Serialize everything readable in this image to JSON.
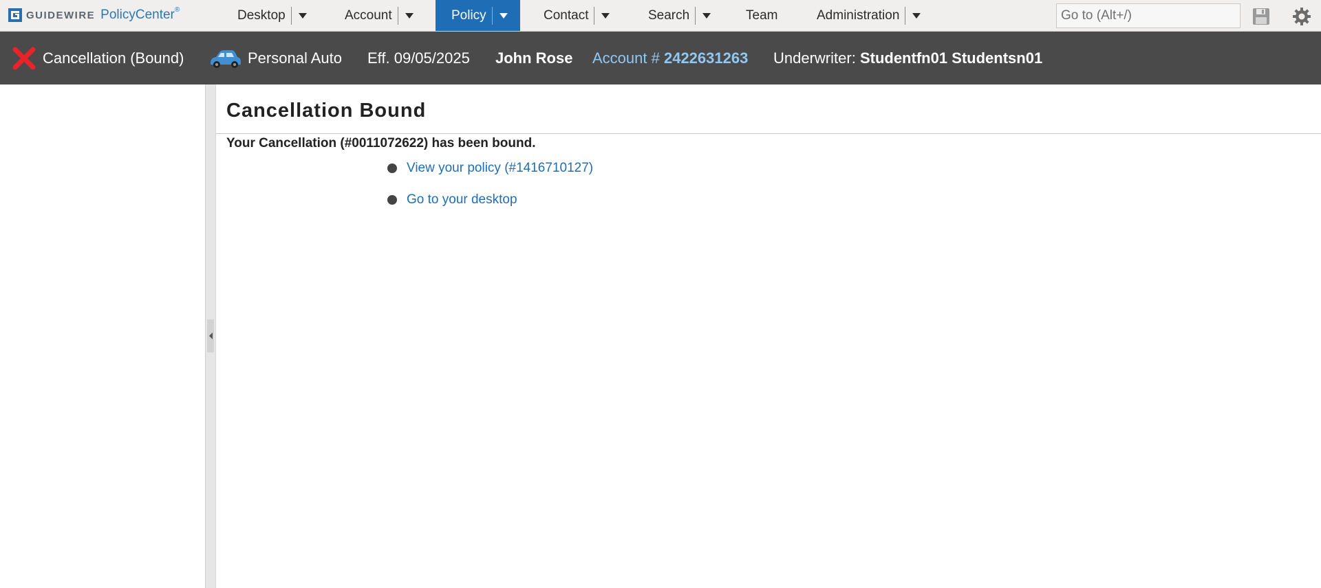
{
  "header": {
    "logo": {
      "brand": "GUIDEWIRE",
      "product": "PolicyCenter",
      "mark": "®"
    },
    "nav": [
      {
        "label": "Desktop",
        "has_menu": true
      },
      {
        "label": "Account",
        "has_menu": true
      },
      {
        "label": "Policy",
        "has_menu": true,
        "active": true
      },
      {
        "label": "Contact",
        "has_menu": true
      },
      {
        "label": "Search",
        "has_menu": true
      },
      {
        "label": "Team",
        "has_menu": false
      },
      {
        "label": "Administration",
        "has_menu": true
      }
    ],
    "goto_placeholder": "Go to (Alt+/)",
    "icons": {
      "save": "save-icon",
      "settings": "gear-icon"
    }
  },
  "infobar": {
    "status": "Cancellation (Bound)",
    "product": "Personal Auto",
    "effective": "Eff. 09/05/2025",
    "insured": "John Rose",
    "account_label": "Account # ",
    "account_number": "2422631263",
    "underwriter_label": "Underwriter: ",
    "underwriter_name": "Studentfn01 Studentsn01"
  },
  "main": {
    "title": "Cancellation Bound",
    "message": "Your Cancellation (#0011072622) has been bound.",
    "links": [
      {
        "label": "View your policy (#1416710127)"
      },
      {
        "label": "Go to your desktop"
      }
    ]
  },
  "colors": {
    "nav_active": "#1f6db4",
    "infobar_bg": "#4a4a4a",
    "link": "#1f6db4",
    "account_accent": "#8fc8f2",
    "cancel_x": "#e8232a"
  }
}
